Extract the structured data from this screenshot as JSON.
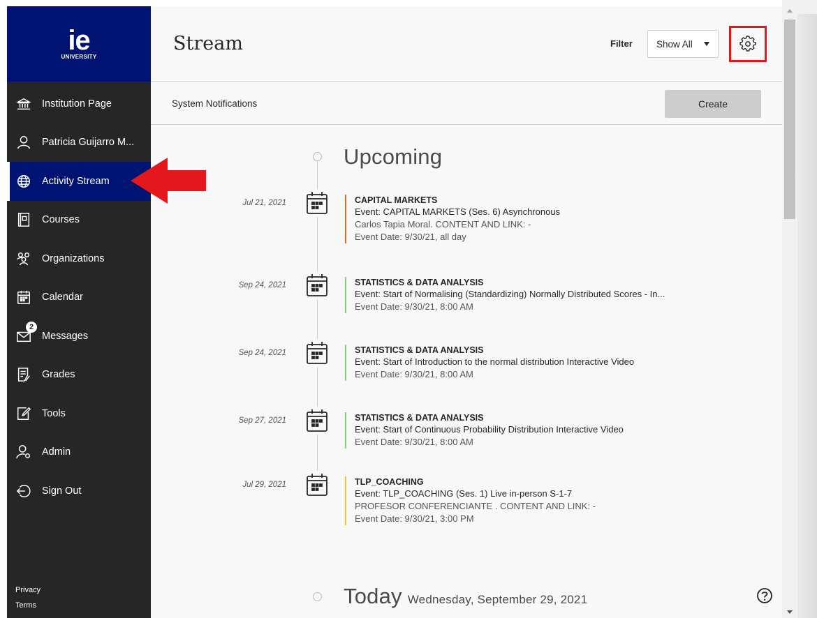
{
  "logo": {
    "mark": "ie",
    "subtitle": "UNIVERSITY"
  },
  "sidebar": {
    "items": [
      {
        "label": "Institution Page",
        "icon": "institution-icon"
      },
      {
        "label": "Patricia Guijarro M...",
        "icon": "user-icon"
      },
      {
        "label": "Activity Stream",
        "icon": "globe-icon",
        "active": true
      },
      {
        "label": "Courses",
        "icon": "courses-icon"
      },
      {
        "label": "Organizations",
        "icon": "organizations-icon"
      },
      {
        "label": "Calendar",
        "icon": "calendar-icon"
      },
      {
        "label": "Messages",
        "icon": "envelope-icon",
        "badge": "2"
      },
      {
        "label": "Grades",
        "icon": "grades-icon"
      },
      {
        "label": "Tools",
        "icon": "tools-icon"
      },
      {
        "label": "Admin",
        "icon": "admin-icon"
      },
      {
        "label": "Sign Out",
        "icon": "sign-out-icon"
      }
    ],
    "footer": {
      "privacy": "Privacy",
      "terms": "Terms"
    }
  },
  "header": {
    "title": "Stream",
    "filter_label": "Filter",
    "filter_value": "Show All"
  },
  "subheader": {
    "system_notifications": "System Notifications",
    "create_label": "Create"
  },
  "stream": {
    "upcoming_title": "Upcoming",
    "events": [
      {
        "date": "Jul 21, 2021",
        "course": "CAPITAL MARKETS",
        "lines": [
          "Event: CAPITAL MARKETS (Ses. 6) Asynchronous",
          "Carlos Tapia Moral. CONTENT AND LINK: -",
          "Event Date: 9/30/21, all day"
        ],
        "accent": "#e06f1f"
      },
      {
        "date": "Sep 24, 2021",
        "course": "STATISTICS & DATA ANALYSIS",
        "lines": [
          "Event: Start of Normalising (Standardizing) Normally Distributed Scores - In...",
          "Event Date: 9/30/21, 8:00 AM"
        ],
        "accent": "#7bd672"
      },
      {
        "date": "Sep 24, 2021",
        "course": "STATISTICS & DATA ANALYSIS",
        "lines": [
          "Event: Start of Introduction to the normal distribution Interactive Video",
          "Event Date: 9/30/21, 8:00 AM"
        ],
        "accent": "#7bd672"
      },
      {
        "date": "Sep 27, 2021",
        "course": "STATISTICS & DATA ANALYSIS",
        "lines": [
          "Event: Start of Continuous Probability Distribution Interactive Video",
          "Event Date: 9/30/21, 8:00 AM"
        ],
        "accent": "#7bd672"
      },
      {
        "date": "Jul 29, 2021",
        "course": "TLP_COACHING",
        "lines": [
          "Event: TLP_COACHING (Ses. 1) Live in-person S-1-7",
          "PROFESOR CONFERENCIANTE . CONTENT AND LINK: -",
          "Event Date: 9/30/21, 3:00 PM"
        ],
        "accent": "#f2c530"
      }
    ],
    "today_title": "Today",
    "today_date": "Wednesday, September 29, 2021"
  },
  "colors": {
    "brand": "#001373",
    "sidebar_bg": "#262626",
    "highlight_red": "#e3171c"
  }
}
